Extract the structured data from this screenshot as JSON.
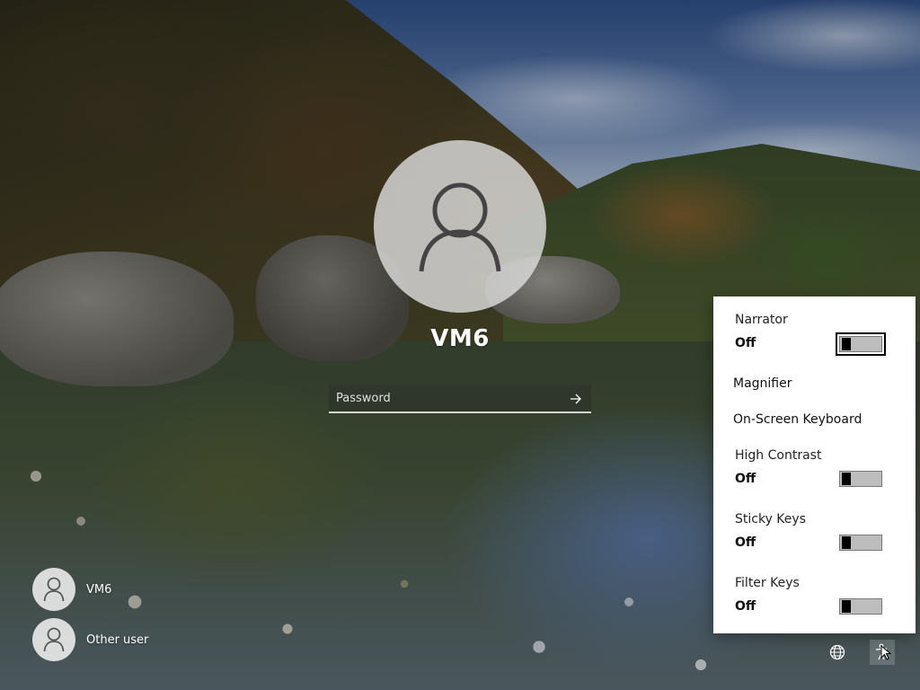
{
  "login": {
    "username": "VM6",
    "password_placeholder": "Password"
  },
  "users": [
    {
      "name": "VM6"
    },
    {
      "name": "Other user"
    }
  ],
  "accessibility": {
    "items": [
      {
        "label": "Narrator",
        "state": "Off",
        "toggle": true
      },
      {
        "label": "Magnifier",
        "toggle": false
      },
      {
        "label": "On-Screen Keyboard",
        "toggle": false
      },
      {
        "label": "High Contrast",
        "state": "Off",
        "toggle": true
      },
      {
        "label": "Sticky Keys",
        "state": "Off",
        "toggle": true
      },
      {
        "label": "Filter Keys",
        "state": "Off",
        "toggle": true
      }
    ]
  },
  "corner_icons": {
    "network": "network-globe-icon",
    "accessibility": "accessibility-icon"
  }
}
